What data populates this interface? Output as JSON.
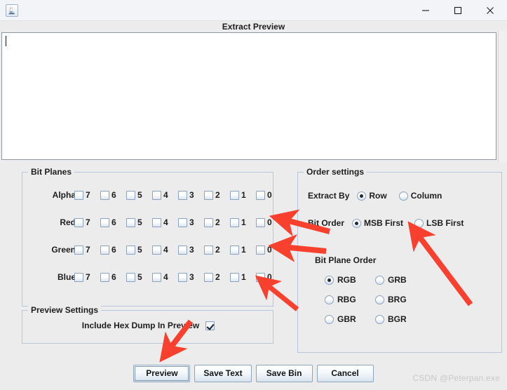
{
  "window": {
    "app_icon": "java-coffee-cup-icon",
    "minimize_label": "minimize-icon",
    "maximize_label": "maximize-icon",
    "close_label": "close-icon",
    "frame_title": "Extract Preview"
  },
  "text_area": {
    "value": "",
    "caret_visible": true
  },
  "bit_planes": {
    "title": "Bit Planes",
    "bits": [
      "7",
      "6",
      "5",
      "4",
      "3",
      "2",
      "1",
      "0"
    ],
    "rows": [
      {
        "label": "Alpha",
        "checked": [
          false,
          false,
          false,
          false,
          false,
          false,
          false,
          false
        ]
      },
      {
        "label": "Red",
        "checked": [
          false,
          false,
          false,
          false,
          false,
          false,
          false,
          false
        ]
      },
      {
        "label": "Green",
        "checked": [
          false,
          false,
          false,
          false,
          false,
          false,
          false,
          false
        ]
      },
      {
        "label": "Blue",
        "checked": [
          false,
          false,
          false,
          false,
          false,
          false,
          false,
          false
        ]
      }
    ]
  },
  "order_settings": {
    "title": "Order settings",
    "extract_by": {
      "label": "Extract By",
      "options": [
        "Row",
        "Column"
      ],
      "selected": "Row"
    },
    "bit_order": {
      "label": "Bit Order",
      "options": [
        "MSB First",
        "LSB First"
      ],
      "selected": "MSB First"
    },
    "bit_plane_order": {
      "label": "Bit Plane Order",
      "options": [
        "RGB",
        "GRB",
        "RBG",
        "BRG",
        "GBR",
        "BGR"
      ],
      "selected": "RGB"
    }
  },
  "preview_settings": {
    "title": "Preview Settings",
    "include_hex_dump": {
      "label": "Include Hex Dump In Preview",
      "checked": true
    }
  },
  "buttons": [
    {
      "label": "Preview",
      "focused": true
    },
    {
      "label": "Save Text",
      "focused": false
    },
    {
      "label": "Save Bin",
      "focused": false
    },
    {
      "label": "Cancel",
      "focused": false
    }
  ],
  "watermark": "CSDN @Peterpan.exe",
  "annotation": {
    "color": "#f8402e",
    "arrow_count": 4
  }
}
